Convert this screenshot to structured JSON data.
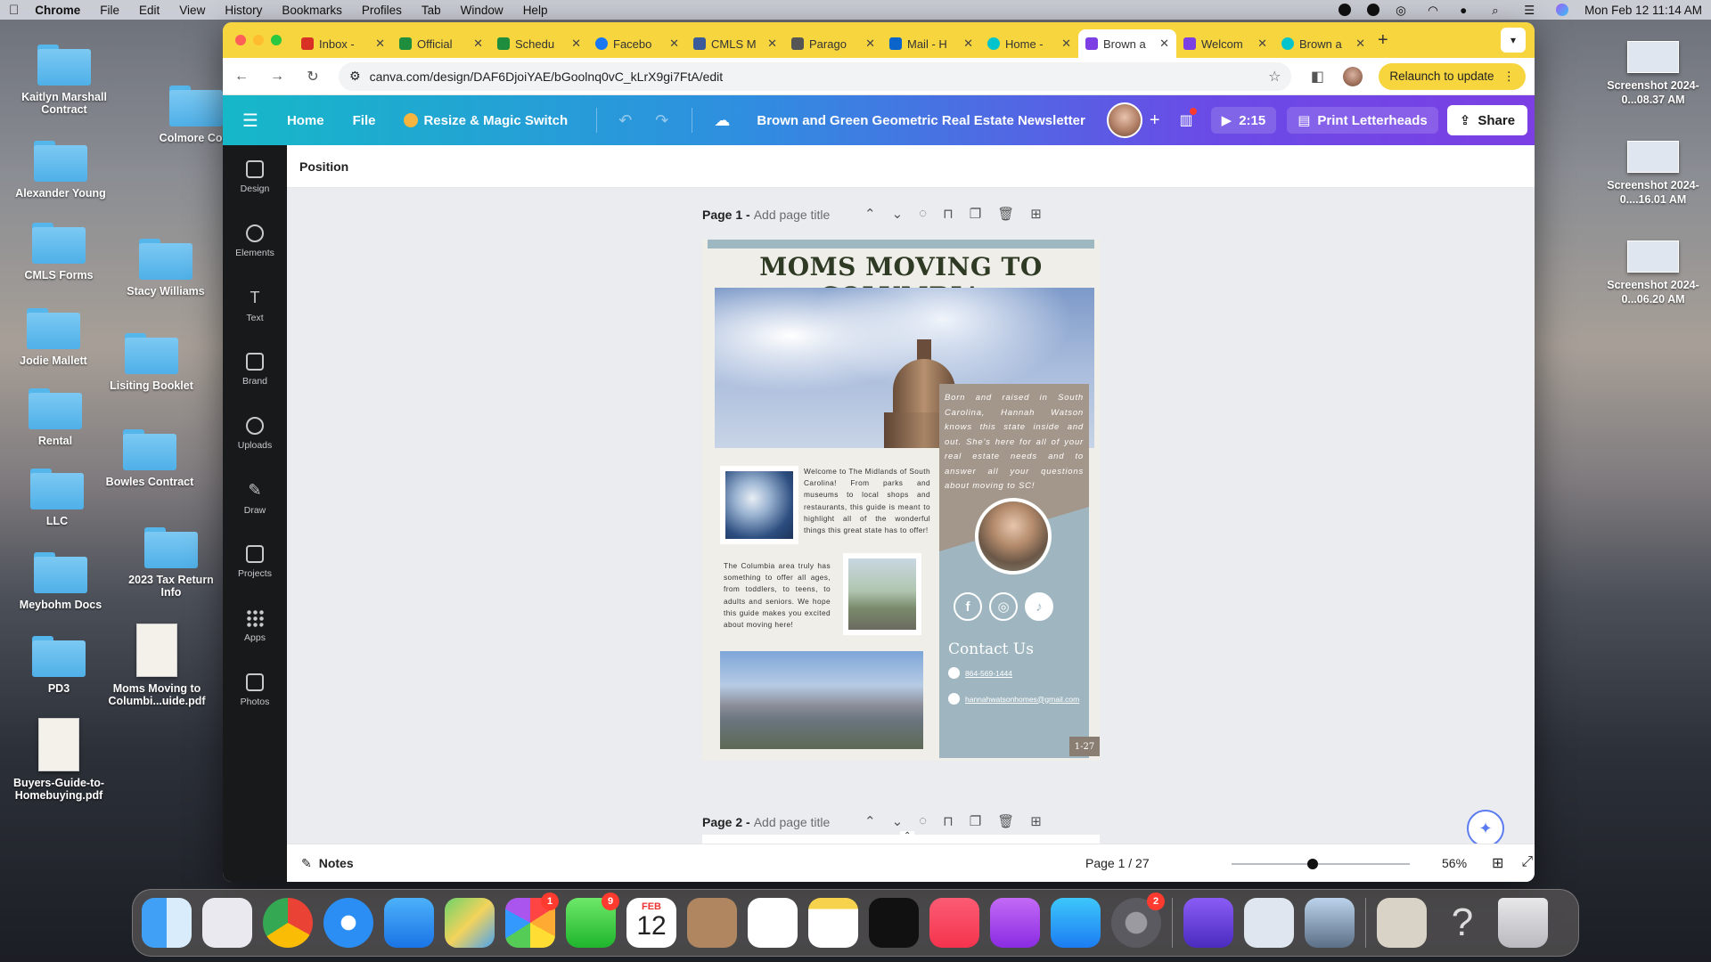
{
  "menubar": {
    "apple": "",
    "app": "Chrome",
    "items": [
      "File",
      "Edit",
      "View",
      "History",
      "Bookmarks",
      "Profiles",
      "Tab",
      "Window",
      "Help"
    ],
    "datetime": "Mon Feb 12  11:14 AM"
  },
  "desktop": {
    "left": [
      {
        "label": "Kaitlyn Marshall Contract"
      },
      {
        "label": "Colmore Cont"
      },
      {
        "label": "Alexander Young"
      },
      {
        "label": "CMLS Forms"
      },
      {
        "label": "Stacy Williams"
      },
      {
        "label": "Jodie Mallett"
      },
      {
        "label": "Lisiting Booklet"
      },
      {
        "label": "Rental"
      },
      {
        "label": "Bowles Contract"
      },
      {
        "label": "LLC"
      },
      {
        "label": "2023 Tax Return Info"
      },
      {
        "label": "Meybohm Docs"
      },
      {
        "label": "PD3"
      },
      {
        "label": "Moms Moving to Columbi...uide.pdf"
      },
      {
        "label": "Buyers-Guide-to-Homebuying.pdf"
      }
    ],
    "right": [
      {
        "label": "Screenshot 2024-0...08.37 AM"
      },
      {
        "label": "Screenshot 2024-0....16.01 AM"
      },
      {
        "label": "Screenshot 2024-0...06.20 AM"
      }
    ]
  },
  "browser": {
    "tabs": [
      {
        "label": "Inbox -",
        "color": "#d93025"
      },
      {
        "label": "Official",
        "color": "#1e8e3e"
      },
      {
        "label": "Schedu",
        "color": "#1e8e3e"
      },
      {
        "label": "Facebo",
        "color": "#1877f2"
      },
      {
        "label": "CMLS M",
        "color": "#3a5a9a"
      },
      {
        "label": "Parago",
        "color": "#555555"
      },
      {
        "label": "Mail - H",
        "color": "#0a64c9"
      },
      {
        "label": "Home -",
        "color": "#00c4cc"
      },
      {
        "label": "Brown a",
        "color": "#7b3fe4",
        "active": true
      },
      {
        "label": "Welcom",
        "color": "#7b3fe4"
      },
      {
        "label": "Brown a",
        "color": "#00c4cc"
      }
    ],
    "url": "canva.com/design/DAF6DjoiYAE/bGoolnq0vC_kLrX9gi7FtA/edit",
    "relaunch": "Relaunch to update"
  },
  "canva": {
    "header": {
      "home": "Home",
      "file": "File",
      "magic": "Resize & Magic Switch",
      "title": "Brown and Green Geometric Real Estate Newsletter",
      "timer": "2:15",
      "print": "Print Letterheads",
      "share": "Share"
    },
    "rail": [
      {
        "label": "Design"
      },
      {
        "label": "Elements"
      },
      {
        "label": "Text"
      },
      {
        "label": "Brand"
      },
      {
        "label": "Uploads"
      },
      {
        "label": "Draw"
      },
      {
        "label": "Projects"
      },
      {
        "label": "Apps"
      },
      {
        "label": "Photos"
      }
    ],
    "subbar": "Position",
    "page1": {
      "num": "Page 1 -",
      "placeholder": "Add page title"
    },
    "page2": {
      "num": "Page 2 -",
      "placeholder": "Add page title"
    },
    "design": {
      "title": "MOMS MOVING TO COLUMBIA",
      "bio": "Born and raised in South Carolina, Hannah Watson knows this state inside and out. She's here for all of your real estate needs and to answer all your questions about moving to SC!",
      "welcome": "Welcome to The Midlands of South Carolina! From parks and museums to local shops and restaurants, this guide is meant to highlight all of the wonderful things this great state has to offer!",
      "columbia": "The Columbia area truly has something to offer all ages, from toddlers, to teens, to adults and seniors. We hope this guide makes you excited about moving here!",
      "contact_title": "Contact Us",
      "phone": "864-569-1444",
      "email": "hannahwatsonhomes@gmail.com",
      "page_num": "1-27"
    },
    "footer": {
      "notes": "Notes",
      "page_indicator": "Page 1 / 27",
      "zoom": "56%"
    }
  },
  "dock": {
    "mail_badge": "",
    "photos_badge": "1",
    "messages_badge": "9",
    "calendar_month": "FEB",
    "calendar_day": "12",
    "settings_badge": "2"
  }
}
